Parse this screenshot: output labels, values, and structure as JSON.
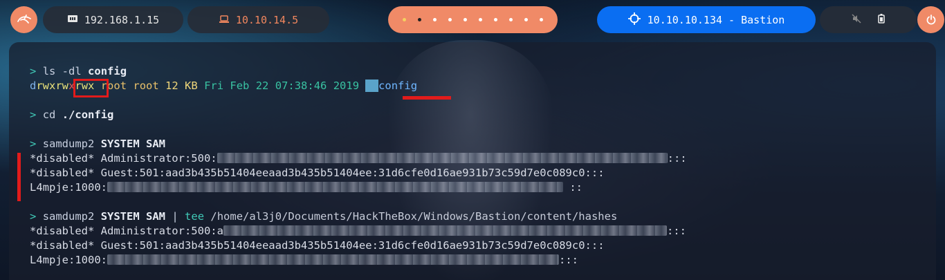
{
  "topbar": {
    "logo_icon": "kali-dragon-icon",
    "local_ip": "192.168.1.15",
    "vpn_ip": "10.10.14.5",
    "workspaces": [
      "1",
      "2",
      "3",
      "4",
      "5",
      "6",
      "7",
      "8",
      "9",
      "10"
    ],
    "active_workspace": "2",
    "target": "10.10.10.134 - Bastion",
    "tray_icons": [
      "mute-icon",
      "battery-icon"
    ],
    "power_icon": "power-icon"
  },
  "terminal": {
    "cmd1_prompt": ">",
    "cmd1": "ls -dl",
    "cmd1_arg": "config",
    "ls_perm_d": "d",
    "ls_perm_user": "rwxrw",
    "ls_perm_group": "x",
    "ls_perm_other": "rwx",
    "ls_owner": "root",
    "ls_group": "root",
    "ls_size": "12 KB",
    "ls_date": "Fri Feb 22 07:38:46 2019",
    "ls_name": "config",
    "cmd2_prompt": ">",
    "cmd2": "cd",
    "cmd2_arg": "./config",
    "cmd3_prompt": ">",
    "cmd3": "samdump2",
    "cmd3_args": "SYSTEM SAM",
    "dump1": [
      {
        "prefix": "*disabled* Administrator:500:",
        "hash": "",
        "suffix": ":::"
      },
      {
        "prefix": "*disabled* Guest:501:aad3b435b51404eeaad3b435b51404ee:31d6cfe0d16ae931b73c59d7e0c089c0:::",
        "hash": "",
        "suffix": ""
      },
      {
        "prefix": "L4mpje:1000:",
        "hash": "",
        "suffix": "::"
      }
    ],
    "cmd4_prompt": ">",
    "cmd4": "samdump2",
    "cmd4_args": "SYSTEM SAM",
    "cmd4_pipe": "|",
    "cmd4_tee": "tee",
    "cmd4_path": "/home/al3j0/Documents/HackTheBox/Windows/Bastion/content/hashes",
    "dump2": [
      {
        "prefix": "*disabled* Administrator:500:a",
        "suffix": ":::"
      },
      {
        "prefix": "*disabled* Guest:501:aad3b435b51404eeaad3b435b51404ee:31d6cfe0d16ae931b73c59d7e0c089c0:::",
        "suffix": ""
      },
      {
        "prefix": "L4mpje:1000:",
        "suffix": ":::"
      }
    ]
  },
  "colors": {
    "accent_orange": "#f08a67",
    "target_blue": "#0a6ef2",
    "highlight_red": "#e21b1b",
    "prompt_teal": "#40c9b7"
  }
}
